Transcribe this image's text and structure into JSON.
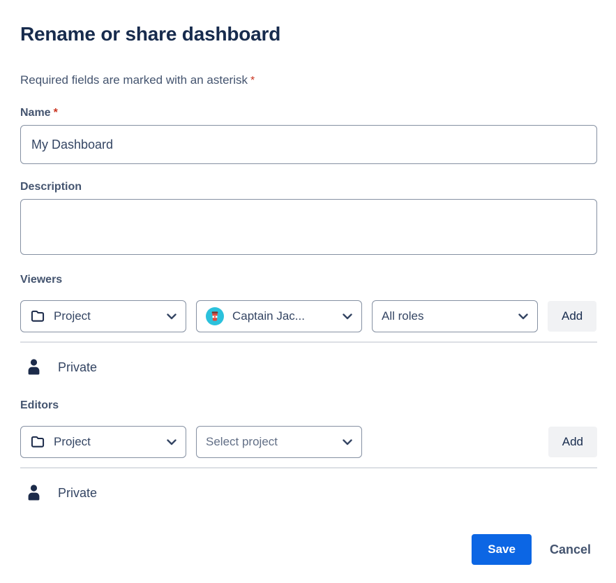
{
  "dialog": {
    "title": "Rename or share dashboard",
    "required_note": {
      "text": "Required fields are marked with an asterisk",
      "asterisk": "*"
    },
    "name_field": {
      "label": "Name",
      "required_marker": "*",
      "value": "My Dashboard"
    },
    "description_field": {
      "label": "Description",
      "value": ""
    },
    "viewers": {
      "label": "Viewers",
      "type_select": {
        "value": "Project",
        "icon": "folder-icon"
      },
      "target_select": {
        "value": "Captain Jac...",
        "icon": "user-avatar"
      },
      "role_select": {
        "value": "All roles"
      },
      "add_button_label": "Add",
      "access_status": "Private",
      "access_icon": "person-icon"
    },
    "editors": {
      "label": "Editors",
      "type_select": {
        "value": "Project",
        "icon": "folder-icon"
      },
      "target_select": {
        "placeholder": "Select project"
      },
      "add_button_label": "Add",
      "access_status": "Private",
      "access_icon": "person-icon"
    },
    "footer": {
      "save_label": "Save",
      "cancel_label": "Cancel"
    },
    "colors": {
      "primary_blue": "#0C66E4",
      "title_text": "#172B4D",
      "label_text": "#44546F",
      "field_border": "#8590A2",
      "divider": "#DCDFE4",
      "subtle_button_bg": "#F1F2F4",
      "required_red": "#CA3521",
      "avatar_bg": "#2BC1DC",
      "avatar_cup_red": "#E2483D",
      "icon_navy": "#1C2B4A"
    }
  }
}
